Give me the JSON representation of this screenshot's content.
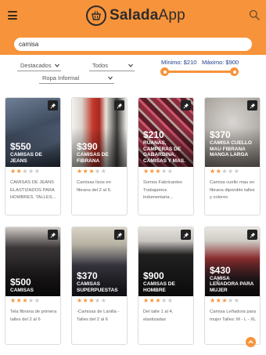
{
  "header": {
    "brand_strong": "Salada",
    "brand_rest": "App",
    "accent": "#f7933a"
  },
  "search": {
    "value": "camisa",
    "placeholder": ""
  },
  "filters": {
    "sort": "Destacados",
    "category": "Todos",
    "subcategory": "Ropa Informal",
    "min_label": "Mínimo: $210",
    "max_label": "Máximo: $900"
  },
  "products": [
    {
      "price": "$550",
      "title": "CAMISAS DE JEANS",
      "rating": 2,
      "desc": "CAMISAS DE JEANS ELASTIZADOS PARA HOMBRES. TALLES..."
    },
    {
      "price": "$390",
      "title": "CAMISAS DE FIBRANA",
      "rating": 3,
      "desc": "Camisas lisos en fibrana del 2 al 6."
    },
    {
      "price": "$210",
      "title": "RUANAS, CAMPERAS DE GABARDINA, CAMISAS Y MAS.",
      "rating": 3,
      "desc": "Somos Fabricantes Trabajamos indumentaria..."
    },
    {
      "price": "$370",
      "title": "CAMISA CUELLO MAU FIBRANA MANGA LARGA",
      "rating": 2,
      "desc": "Camisa cuello mau en fibrana diponible talles y colores"
    },
    {
      "price": "$500",
      "title": "CAMISAS",
      "rating": 3,
      "desc": "Tela fibrana de primera talles del 2 al 6"
    },
    {
      "price": "$370",
      "title": "CAMISAS SUPERPUESTAS",
      "rating": 3,
      "desc": "-Camisas de Lanilla - Talles del 2 al 6"
    },
    {
      "price": "$900",
      "title": "CAMISAS DE HOMBRE",
      "rating": 3,
      "desc": "Del talle 1 al 4, elastizadas"
    },
    {
      "price": "$430",
      "title": "CAMISA LEÑADORA PARA MUJER",
      "rating": 3,
      "desc": "Camisa Leñadora para mujer Talles: M - L - XL"
    }
  ]
}
